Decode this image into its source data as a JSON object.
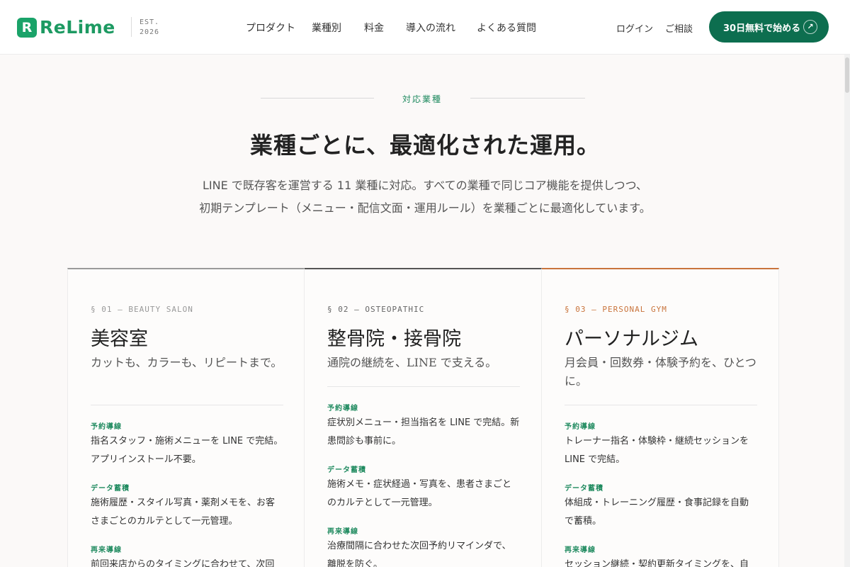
{
  "header": {
    "logo_mark": "R",
    "logo_text": "ReLime",
    "est": "EST.\n2026",
    "nav": [
      "プロダクト",
      "業種別",
      "料金",
      "導入の流れ",
      "よくある質問"
    ],
    "login": "ログイン",
    "consult": "ご相談",
    "cta_label": "30日無料で始める",
    "cta_icon": "↗"
  },
  "section": {
    "eyebrow": "対応業種",
    "title": "業種ごとに、最適化された運用。",
    "desc_line1": "LINE で既存客を運営する 11 業種に対応。すべての業種で同じコア機能を提供しつつ、",
    "desc_line2": "初期テンプレート（メニュー・配信文面・運用ルール）を業種ごとに最適化しています。"
  },
  "colors": {
    "brand": "#1aa369",
    "cta_bg": "#0d6e4f",
    "accent_orange": "#c9743c",
    "label_green": "#1f8a5f"
  },
  "cards": [
    {
      "tag": "§ 01 — BEAUTY SALON",
      "title": "美容室",
      "lead": "カットも、カラーも、リピートまで。",
      "features": [
        {
          "label": "予約導線",
          "text": "指名スタッフ・施術メニューを LINE で完結。アプリインストール不要。"
        },
        {
          "label": "データ蓄積",
          "text": "施術履歴・スタイル写真・薬剤メモを、お客さまごとのカルテとして一元管理。"
        },
        {
          "label": "再来導線",
          "text": "前回来店からのタイミングに合わせて、次回提"
        }
      ]
    },
    {
      "tag": "§ 02 — OSTEOPATHIC",
      "title": "整骨院・接骨院",
      "lead": "通院の継続を、LINE で支える。",
      "features": [
        {
          "label": "予約導線",
          "text": "症状別メニュー・担当指名を LINE で完結。新患問診も事前に。"
        },
        {
          "label": "データ蓄積",
          "text": "施術メモ・症状経過・写真を、患者さまごとのカルテとして一元管理。"
        },
        {
          "label": "再来導線",
          "text": "治療間隔に合わせた次回予約リマインダで、離脱を防ぐ。"
        }
      ]
    },
    {
      "tag": "§ 03 — PERSONAL GYM",
      "title": "パーソナルジム",
      "lead": "月会員・回数券・体験予約を、ひとつに。",
      "features": [
        {
          "label": "予約導線",
          "text": "トレーナー指名・体験枠・継続セッションを LINE で完結。"
        },
        {
          "label": "データ蓄積",
          "text": "体組成・トレーニング履歴・食事記録を自動で蓄積。"
        },
        {
          "label": "再来導線",
          "text": "セッション継続・契約更新タイミングを、自動で"
        }
      ]
    }
  ]
}
